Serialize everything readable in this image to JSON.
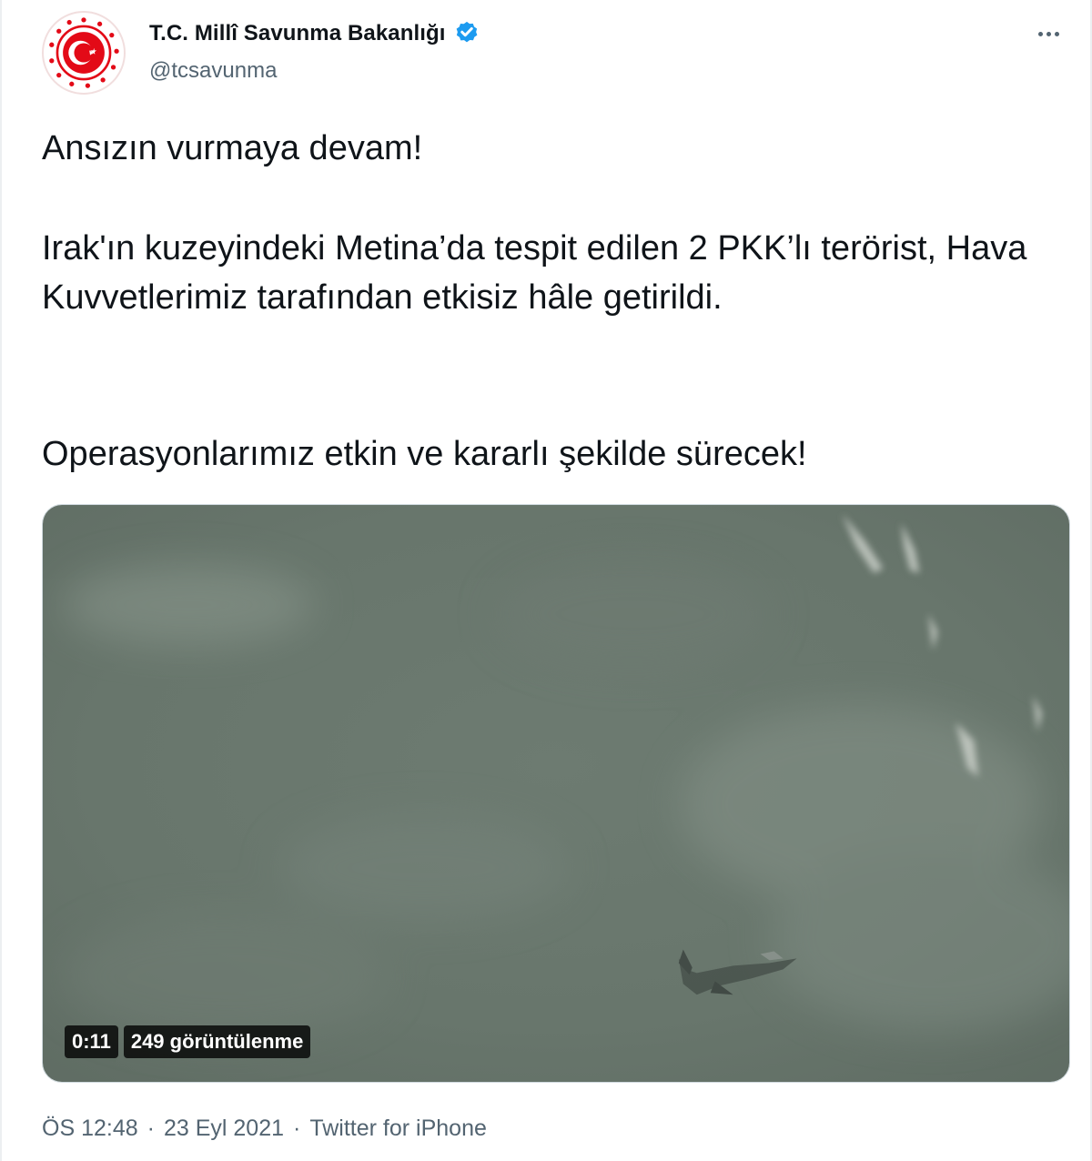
{
  "account": {
    "display_name": "T.C. Millî Savunma Bakanlığı",
    "handle": "@tcsavunma",
    "verified": true
  },
  "tweet": {
    "intro": "Ansızın vurmaya devam!",
    "main": "Irak'ın kuzeyindeki Metina’da tespit edilen 2 PKK’lı terörist, Hava Kuvvetlerimiz tarafından etkisiz hâle getirildi.",
    "outro": "Operasyonlarımız etkin ve kararlı şekilde sürecek!"
  },
  "video": {
    "duration": "0:11",
    "views": "249 görüntülenme"
  },
  "meta": {
    "time": "ÖS 12:48",
    "separator": "·",
    "date": "23 Eyl 2021",
    "source": "Twitter for iPhone"
  },
  "colors": {
    "text": "#0f1419",
    "secondary": "#536471",
    "verified": "#1d9bf0",
    "logo_red": "#e30a17"
  },
  "icons": {
    "verified": "verified-badge-icon",
    "more": "more-dots-icon",
    "avatar": "ministry-seal-logo"
  }
}
